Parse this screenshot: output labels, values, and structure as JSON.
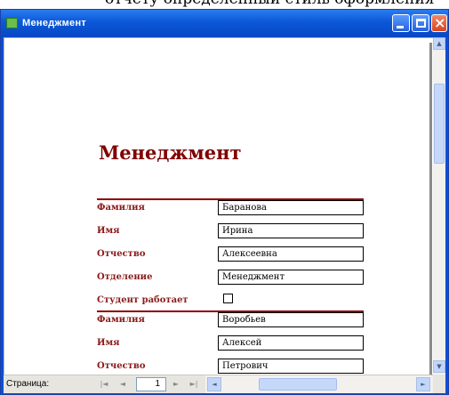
{
  "top_caption": "отчету определенный стиль оформления",
  "window": {
    "title": "Менеджмент"
  },
  "report": {
    "title": "Менеджмент",
    "labels": {
      "last_name": "Фамилия",
      "first_name": "Имя",
      "patronymic": "Отчество",
      "department": "Отделение",
      "student_works": "Студент работает"
    },
    "records": [
      {
        "last_name": "Баранова",
        "first_name": "Ирина",
        "patronymic": "Алексеевна",
        "department": "Менеджмент",
        "student_works": false
      },
      {
        "last_name": "Воробьев",
        "first_name": "Алексей",
        "patronymic": "Петрович"
      }
    ]
  },
  "navigation": {
    "page_label": "Страница:",
    "current_page": "1"
  },
  "icons": {
    "app": "form-icon",
    "first": "first-record-icon",
    "prev": "previous-record-icon",
    "next": "next-record-icon",
    "last": "last-record-icon"
  },
  "colors": {
    "title_bar": "#0b57d8",
    "report_text": "#800000"
  }
}
